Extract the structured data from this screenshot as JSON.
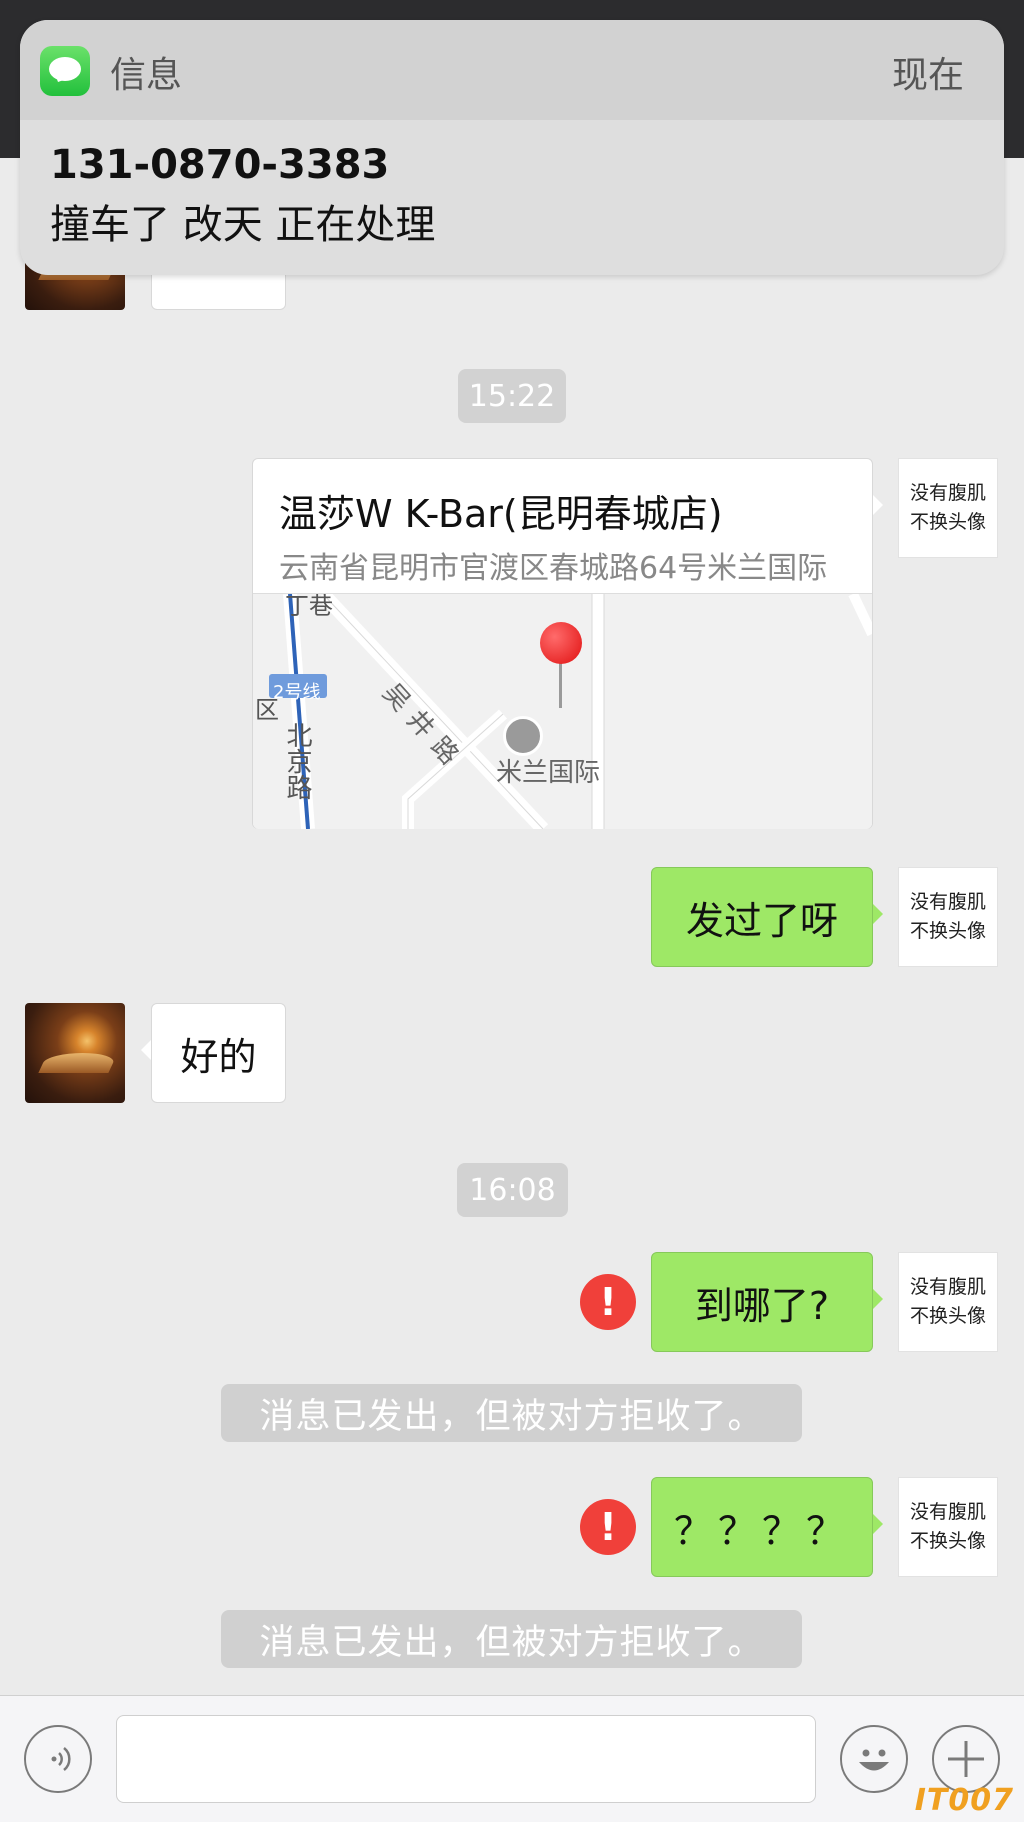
{
  "notification": {
    "app_name": "信息",
    "time": "现在",
    "sender": "131-0870-3383",
    "body": "撞车了 改天 正在处理"
  },
  "chat": {
    "my_avatar_text": [
      "没有腹肌",
      "不换头像"
    ],
    "timestamps": [
      "15:22",
      "16:08"
    ],
    "location": {
      "title": "温莎W K-Bar(昆明春城店)",
      "address": "云南省昆明市官渡区春城路64号米兰国际",
      "map_labels": {
        "line": "2号线",
        "road1": "北京路",
        "road2": "吴井路",
        "poi": "米兰国际",
        "district": "区",
        "top": "丁巷"
      }
    },
    "messages": [
      {
        "side": "right",
        "text": "发过了呀"
      },
      {
        "side": "left",
        "text": "好的"
      },
      {
        "side": "right",
        "text": "到哪了?",
        "error": true
      },
      {
        "side": "right",
        "text": "？？？？",
        "error": true
      }
    ],
    "system_notice": "消息已发出，但被对方拒收了。",
    "error_mark": "!"
  },
  "input_bar": {
    "voice_icon": "voice-icon",
    "emoji_icon": "emoji-icon",
    "plus_icon": "plus-icon"
  },
  "watermark": "IT007"
}
